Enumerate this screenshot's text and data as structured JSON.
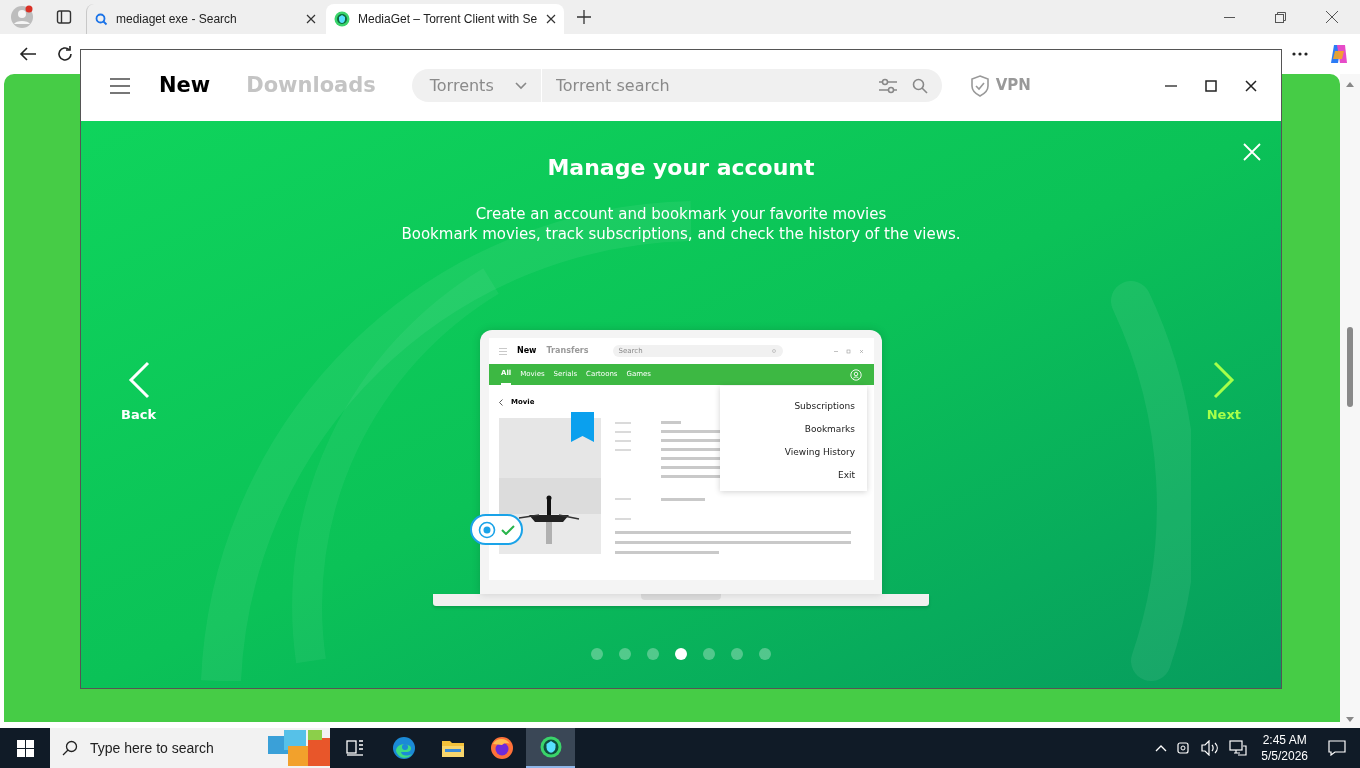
{
  "browser": {
    "tabs": [
      {
        "title": "mediaget exe - Search",
        "kind": "search",
        "selected": false
      },
      {
        "title": "MediaGet – Torrent Client with Se",
        "kind": "site",
        "selected": true
      }
    ]
  },
  "app": {
    "nav": [
      {
        "label": "New",
        "selected": true
      },
      {
        "label": "Downloads",
        "selected": false
      }
    ],
    "search": {
      "category": "Torrents",
      "placeholder": "Torrent search"
    },
    "vpn": "VPN"
  },
  "slide": {
    "title": "Manage your account",
    "lines": [
      "Create an account and bookmark your favorite movies",
      "Bookmark movies, track subscriptions, and check the history of the views."
    ],
    "back": "Back",
    "next": "Next",
    "dots": [
      {
        "selected": false
      },
      {
        "selected": false
      },
      {
        "selected": false
      },
      {
        "selected": true
      },
      {
        "selected": false
      },
      {
        "selected": false
      },
      {
        "selected": false
      }
    ]
  },
  "mockup": {
    "nav": [
      {
        "label": "New",
        "selected": true
      },
      {
        "label": "Transfers",
        "selected": false
      }
    ],
    "search_placeholder": "Search",
    "categories": [
      {
        "label": "All",
        "selected": true
      },
      {
        "label": "Movies",
        "selected": false
      },
      {
        "label": "Serials",
        "selected": false
      },
      {
        "label": "Cartoons",
        "selected": false
      },
      {
        "label": "Games",
        "selected": false
      }
    ],
    "heading": "Movie",
    "menu": [
      "Subscriptions",
      "Bookmarks",
      "Viewing History",
      "Exit"
    ]
  },
  "taskbar": {
    "search_placeholder": "Type here to search",
    "apps": [
      {
        "kind": "taskview",
        "active": false
      },
      {
        "kind": "edge",
        "active": false
      },
      {
        "kind": "explorer",
        "active": false
      },
      {
        "kind": "firefox",
        "active": false
      },
      {
        "kind": "mediaget",
        "active": true
      }
    ],
    "time": "2:45 AM",
    "date": "5/5/2026"
  }
}
